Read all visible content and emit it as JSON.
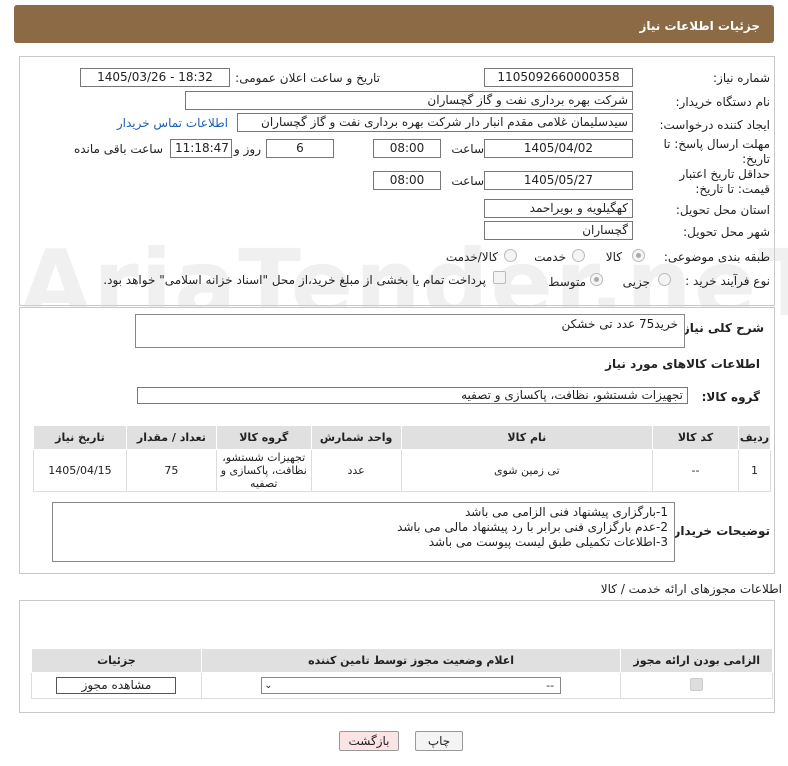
{
  "header": {
    "title": "جزئیات اطلاعات نیاز"
  },
  "form": {
    "need_number_label": "شماره نیاز:",
    "need_number": "1105092660000358",
    "announce_label": "تاریخ و ساعت اعلان عمومی:",
    "announce_value": "1405/03/26 - 18:32",
    "buyer_org_label": "نام دستگاه خریدار:",
    "buyer_org": "شرکت بهره برداری نفت و گاز گچساران",
    "creator_label": "ایجاد کننده درخواست:",
    "creator": "سیدسلیمان غلامی مقدم انبار دار شرکت بهره برداری نفت و گاز گچساران",
    "buyer_contact_link": "اطلاعات تماس خریدار",
    "deadline_label": "مهلت ارسال پاسخ: تا تاریخ:",
    "deadline_date": "1405/04/02",
    "time_label": "ساعت",
    "deadline_time": "08:00",
    "days": "6",
    "days_label": "روز و",
    "remaining": "11:18:47",
    "remaining_label": "ساعت باقی مانده",
    "validity_label": "حداقل تاریخ اعتبار قیمت: تا تاریخ:",
    "validity_date": "1405/05/27",
    "validity_time": "08:00",
    "province_label": "استان محل تحویل:",
    "province": "کهگیلویه و بویراحمد",
    "city_label": "شهر محل تحویل:",
    "city": "گچساران",
    "category_label": "طبقه بندی موضوعی:",
    "cat_goods": "کالا",
    "cat_service": "خدمت",
    "cat_goods_service": "کالا/خدمت",
    "process_label": "نوع فرآیند خرید :",
    "proc_partial": "جزیی",
    "proc_medium": "متوسط",
    "payment_note": "پرداخت تمام یا بخشی از مبلغ خرید،از محل \"اسناد خزانه اسلامی\" خواهد بود."
  },
  "watermark": "AriaTender.neT",
  "need": {
    "desc_label": "شرح کلی نیاز:",
    "desc": "خرید75 عدد تی خشکن",
    "goods_info_title": "اطلاعات کالاهای مورد نیاز",
    "group_label": "گروه کالا:",
    "group_value": "تجهیزات شستشو، نظافت، پاکسازی و تصفیه",
    "table": {
      "headers": [
        "ردیف",
        "کد کالا",
        "نام کالا",
        "واحد شمارش",
        "گروه کالا",
        "تعداد / مقدار",
        "تاریخ نیاز"
      ],
      "rows": [
        [
          "1",
          "--",
          "تی زمین شوی",
          "عدد",
          "تجهیزات شستشو، نظافت، پاکسازی و تصفیه",
          "75",
          "1405/04/15"
        ]
      ]
    },
    "buyer_notes_label": "توضیحات خریدار:",
    "buyer_notes": [
      "1-بارگزاری پیشنهاد فنی الزامی می باشد",
      "2-عدم بارگزاری فنی برابر با رد پیشنهاد مالی می باشد",
      "3-اطلاعات تکمیلی طبق لیست پیوست می باشد"
    ]
  },
  "permits": {
    "title": "اطلاعات مجوزهای ارائه خدمت / کالا",
    "headers": [
      "الزامی بودن ارائه مجوز",
      "اعلام وضعیت مجوز توسط تامین کننده",
      "جزئیات"
    ],
    "select_value": "--",
    "view_button": "مشاهده مجوز"
  },
  "footer": {
    "print": "چاپ",
    "back": "بازگشت"
  },
  "colors": {
    "header_bg": "#8b6a45",
    "back_bg": "#fde4e4",
    "link": "#1a5fb4"
  }
}
